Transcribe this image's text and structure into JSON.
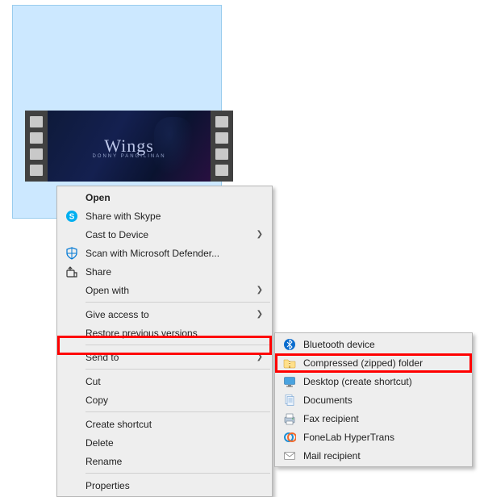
{
  "video": {
    "title": "Wings",
    "subtitle": "DONNY PANGILINAN"
  },
  "menu": {
    "open": "Open",
    "skype": "Share with Skype",
    "cast": "Cast to Device",
    "defender": "Scan with Microsoft Defender...",
    "share": "Share",
    "openwith": "Open with",
    "giveaccess": "Give access to",
    "restore": "Restore previous versions",
    "sendto": "Send to",
    "cut": "Cut",
    "copy": "Copy",
    "shortcut": "Create shortcut",
    "delete": "Delete",
    "rename": "Rename",
    "properties": "Properties"
  },
  "submenu": {
    "bluetooth": "Bluetooth device",
    "zip": "Compressed (zipped) folder",
    "desktop": "Desktop (create shortcut)",
    "documents": "Documents",
    "fax": "Fax recipient",
    "fonelab": "FoneLab HyperTrans",
    "mail": "Mail recipient"
  }
}
